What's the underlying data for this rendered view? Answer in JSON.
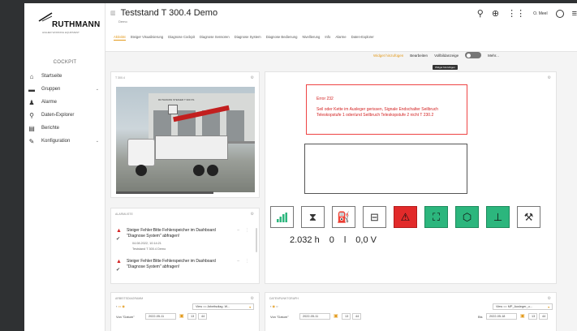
{
  "brand": {
    "name": "RUTHMANN",
    "tagline": "HIGHER WORKING EQUIPMENT"
  },
  "sidebar": {
    "section": "COCKPIT",
    "items": [
      {
        "label": "Startseite",
        "icon": "home-icon",
        "glyph": "⌂"
      },
      {
        "label": "Gruppen",
        "icon": "folder-icon",
        "glyph": "▬"
      },
      {
        "label": "Alarme",
        "icon": "bell-icon",
        "glyph": "♟"
      },
      {
        "label": "Daten-Explorer",
        "icon": "telescope-icon",
        "glyph": "⚲"
      },
      {
        "label": "Berichte",
        "icon": "report-icon",
        "glyph": "▤"
      },
      {
        "label": "Konfiguration",
        "icon": "wrench-icon",
        "glyph": "✎"
      }
    ]
  },
  "header": {
    "title": "Teststand T 300.4 Demo",
    "subtitle": "Demo",
    "user": "O. Meel",
    "tabs": [
      "Aktivität",
      "Steiger Visualisierung",
      "Diagnose Cockpit",
      "Diagnose Sensoren",
      "Diagnose System",
      "Diagnose Bedienung",
      "Nivellierung",
      "Info",
      "Alarme",
      "Daten-Explorer"
    ],
    "actions": {
      "add": "Widget hinzufügen",
      "edit": "Bearbeiten",
      "fullscreen": "Vollbildanzeige",
      "more": "Mehr..."
    },
    "tooltip": "Widget hinzufügen"
  },
  "image_widget": {
    "title": "T 300.4",
    "banner": "RUTHMANN STEIGER T 300 XS"
  },
  "alarm_widget": {
    "title": "ALARMLISTE",
    "alarms": [
      {
        "text": "Steiger Fehler:Bitte Fehlerspeicher im Dashboard \"Diagnose System\" abfragen!",
        "date": "04.08.2022, 10:14:21",
        "source": "Teststand T 300.4 Demo"
      },
      {
        "text": "Steiger Fehler:Bitte Fehlerspeicher im Dashboard \"Diagnose System\" abfragen!",
        "date": "",
        "source": ""
      }
    ]
  },
  "status_widget": {
    "error_title": "Error 232",
    "error_message": "Seil oder Kette im Ausleger gerissen, Signale Endschalter Seilbruch Teleskopstufe 1 oder/und Seilbruch Teleskopstufe 2 nicht T 230.2",
    "tiles": [
      {
        "icon": "signal-icon",
        "glyph": "▮",
        "state": "normal"
      },
      {
        "icon": "hourglass-icon",
        "glyph": "⧗",
        "state": "normal"
      },
      {
        "icon": "fuel-icon",
        "glyph": "⛽",
        "state": "normal"
      },
      {
        "icon": "battery-icon",
        "glyph": "⊟",
        "state": "normal"
      },
      {
        "icon": "warning-icon",
        "glyph": "⚠",
        "state": "red"
      },
      {
        "icon": "frame-icon",
        "glyph": "⛶",
        "state": "green"
      },
      {
        "icon": "engine-icon",
        "glyph": "⬡",
        "state": "green"
      },
      {
        "icon": "outrigger-icon",
        "glyph": "⊥",
        "state": "green"
      },
      {
        "icon": "crane-icon",
        "glyph": "⚒",
        "state": "normal"
      }
    ],
    "readings": [
      "2.032 h",
      "0",
      "l",
      "0,0 V"
    ]
  },
  "work_widget": {
    "title": "ARBEITSDIAGRAMM",
    "view": "View == Arbeitsdiag. W...",
    "from_label": "Von \"Datum\"",
    "from_date": "2022-05-11",
    "hour": "13",
    "minute": "44"
  },
  "datapoint_widget": {
    "title": "DATENPUNKTGRAPH",
    "view": "View == MP_Ausleger_u...",
    "from_label": "Von \"Datum\"",
    "from_date": "2022-05-11",
    "hour": "13",
    "minute": "44",
    "to_label": "Bis",
    "to_date": "2022-05-18",
    "to_hour": "13",
    "to_minute": "44"
  },
  "colors": {
    "accent": "#e39a1c",
    "alarm": "#d32222",
    "ok": "#2cb67d"
  }
}
